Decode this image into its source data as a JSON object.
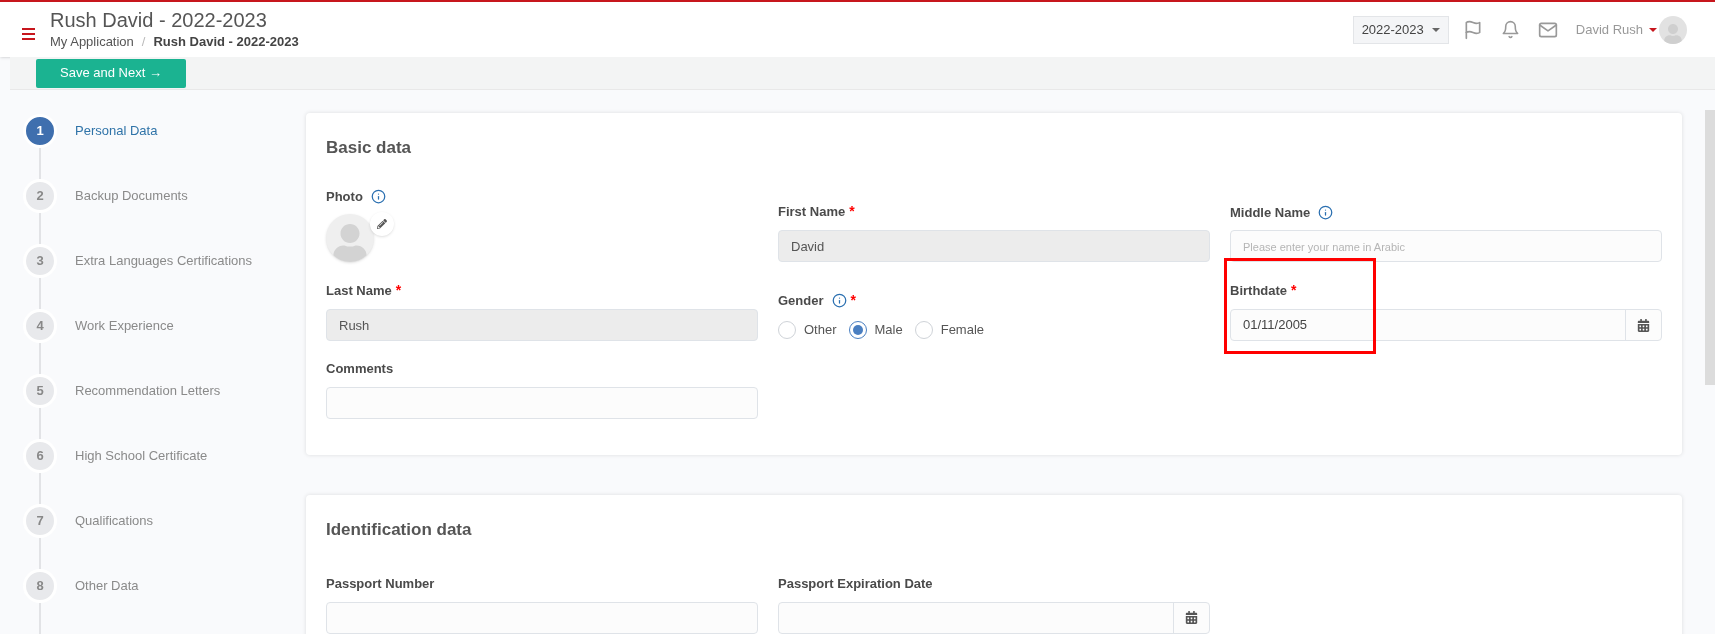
{
  "header": {
    "title": "Rush David - 2022-2023",
    "breadcrumb": [
      {
        "label": "My Application",
        "current": false
      },
      {
        "label": "Rush David - 2022-2023",
        "current": true
      }
    ],
    "separator": "/",
    "year_select": "2022-2023",
    "user_name": "David Rush"
  },
  "toolbar": {
    "save_button": "Save and Next →"
  },
  "steps": [
    {
      "number": "1",
      "label": "Personal Data",
      "selected": true
    },
    {
      "number": "2",
      "label": "Backup Documents",
      "selected": false
    },
    {
      "number": "3",
      "label": "Extra Languages Certifications",
      "selected": false
    },
    {
      "number": "4",
      "label": "Work Experience",
      "selected": false
    },
    {
      "number": "5",
      "label": "Recommendation Letters",
      "selected": false
    },
    {
      "number": "6",
      "label": "High School Certificate",
      "selected": false
    },
    {
      "number": "7",
      "label": "Qualifications",
      "selected": false
    },
    {
      "number": "8",
      "label": "Other Data",
      "selected": false
    }
  ],
  "basic_data": {
    "title": "Basic data",
    "fields": [
      {
        "kind": "photo",
        "label": "Photo",
        "info": true
      },
      {
        "kind": "text",
        "label": "First Name",
        "info": false,
        "required_mark": "*",
        "value": "David",
        "disabled": true
      },
      {
        "kind": "text",
        "label": "Middle Name",
        "info": true,
        "placeholder": "Please enter your name in Arabic",
        "disabled": false
      },
      {
        "kind": "text",
        "label": "Last Name",
        "info": false,
        "required_mark": "*",
        "value": "Rush",
        "disabled": true
      },
      {
        "kind": "radio",
        "label": "Gender",
        "info": true,
        "required_mark": "*",
        "options": [
          {
            "label": "Other",
            "selected": false
          },
          {
            "label": "Male",
            "selected": true
          },
          {
            "label": "Female",
            "selected": false
          }
        ]
      },
      {
        "kind": "date",
        "label": "Birthdate",
        "info": false,
        "required_mark": "*",
        "value": "01/11/2005",
        "highlighted": true
      },
      {
        "kind": "text",
        "label": "Comments",
        "info": false,
        "disabled": false
      }
    ]
  },
  "identification_data": {
    "title": "Identification data",
    "fields": [
      {
        "kind": "text",
        "label": "Passport Number",
        "info": false,
        "disabled": false
      },
      {
        "kind": "date",
        "label": "Passport Expiration Date",
        "info": false,
        "highlighted": false
      }
    ]
  }
}
